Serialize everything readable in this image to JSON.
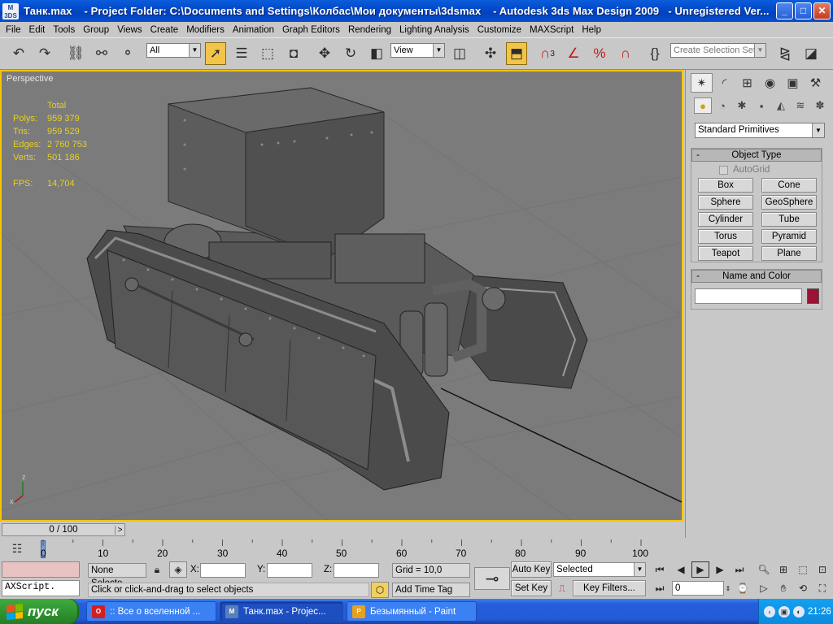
{
  "window": {
    "icon_text": "M 3DS",
    "title": "Танк.max    - Project Folder: C:\\Documents and Settings\\Колбас\\Мои документы\\3dsmax    - Autodesk 3ds Max Design 2009   - Unregistered Ver...",
    "minimize": "_",
    "maximize": "□",
    "close": "✕"
  },
  "menu": [
    "File",
    "Edit",
    "Tools",
    "Group",
    "Views",
    "Create",
    "Modifiers",
    "Animation",
    "Graph Editors",
    "Rendering",
    "Lighting Analysis",
    "Customize",
    "MAXScript",
    "Help"
  ],
  "toolbar": {
    "filter_value": "All",
    "refcoord_value": "View",
    "selection_set_placeholder": "Create Selection Set",
    "snap_angle": "3",
    "snap_label": "%"
  },
  "viewport": {
    "label": "Perspective",
    "stats_header": "Total",
    "stats": [
      {
        "key": "Polys:",
        "value": "959 379"
      },
      {
        "key": "Tris:",
        "value": "959 529"
      },
      {
        "key": "Edges:",
        "value": "2 760 753"
      },
      {
        "key": "Verts:",
        "value": "501 186"
      }
    ],
    "fps_key": "FPS:",
    "fps_value": "14,704",
    "axis_x": "x",
    "axis_z": "z"
  },
  "command_panel": {
    "category": "Standard Primitives",
    "object_type_title": "Object Type",
    "autogrid_label": "AutoGrid",
    "buttons": [
      "Box",
      "Cone",
      "Sphere",
      "GeoSphere",
      "Cylinder",
      "Tube",
      "Torus",
      "Pyramid",
      "Teapot",
      "Plane"
    ],
    "name_color_title": "Name and Color",
    "name_value": "",
    "object_color": "#9a1234",
    "collapse_symbol": "-"
  },
  "timeline": {
    "frame_display": "0 / 100",
    "prev": "<",
    "next": ">",
    "ticks": [
      "0",
      "10",
      "20",
      "30",
      "40",
      "50",
      "60",
      "70",
      "80",
      "90",
      "100"
    ]
  },
  "status": {
    "script_text": "AXScript.",
    "selection_text": "None Selecte",
    "x_label": "X:",
    "y_label": "Y:",
    "z_label": "Z:",
    "x_value": "",
    "y_value": "",
    "z_value": "",
    "grid_text": "Grid = 10,0",
    "prompt_text": "Click or click-and-drag to select objects",
    "add_time_tag": "Add Time Tag",
    "auto_key": "Auto Key",
    "set_key": "Set Key",
    "key_mode_value": "Selected",
    "key_filters": "Key Filters...",
    "current_frame": "0"
  },
  "taskbar": {
    "start_label": "пуск",
    "tasks": [
      {
        "label": ":: Все о вселенной ...",
        "icon": "O",
        "icon_color": "#d02020",
        "active": false
      },
      {
        "label": "Танк.max    - Projec...",
        "icon": "M",
        "icon_color": "#5a7fb8",
        "active": true
      },
      {
        "label": "Безымянный - Paint",
        "icon": "P",
        "icon_color": "#e8a020",
        "active": false
      }
    ],
    "clock": "21:26"
  }
}
